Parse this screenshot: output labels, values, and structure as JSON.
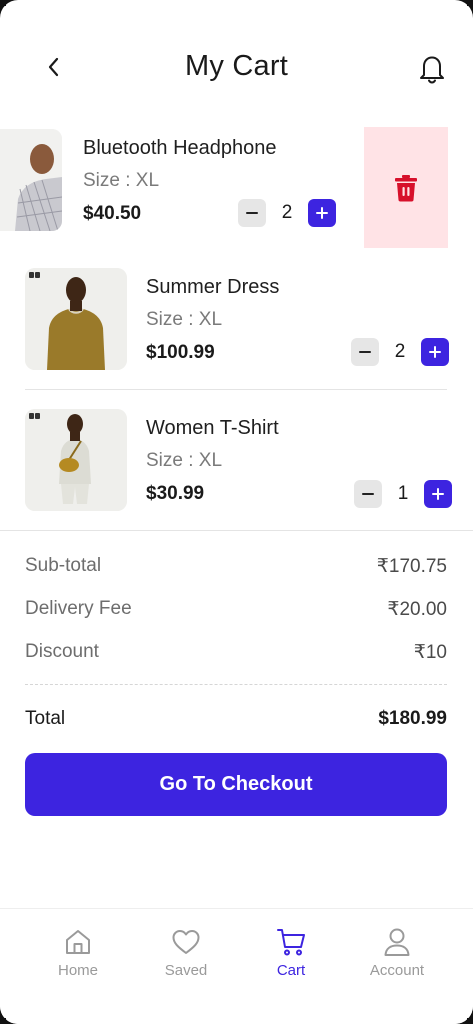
{
  "header": {
    "title": "My Cart",
    "back_icon": "chevron-left-icon",
    "bell_icon": "bell-icon"
  },
  "cart_items": [
    {
      "name": "Bluetooth Headphone",
      "size": "Size : XL",
      "price": "$40.50",
      "quantity": "2",
      "swiped": true
    },
    {
      "name": "Summer Dress",
      "size": "Size : XL",
      "price": "$100.99",
      "quantity": "2"
    },
    {
      "name": "Women T-Shirt",
      "size": "Size : XL",
      "price": "$30.99",
      "quantity": "1"
    }
  ],
  "delete_icon": "trash-icon",
  "summary": {
    "subtotal_label": "Sub-total",
    "subtotal_value": "₹170.75",
    "delivery_label": "Delivery Fee",
    "delivery_value": "₹20.00",
    "discount_label": "Discount",
    "discount_value": "₹10",
    "total_label": "Total",
    "total_value": "$180.99"
  },
  "checkout_label": "Go To Checkout",
  "nav": [
    {
      "label": "Home",
      "icon": "home-icon"
    },
    {
      "label": "Saved",
      "icon": "heart-icon"
    },
    {
      "label": "Cart",
      "icon": "cart-icon",
      "active": true
    },
    {
      "label": "Account",
      "icon": "user-icon"
    }
  ],
  "colors": {
    "accent": "#3d24e0",
    "delete_bg": "#ffe3e6",
    "delete_icon": "#d7102b"
  }
}
